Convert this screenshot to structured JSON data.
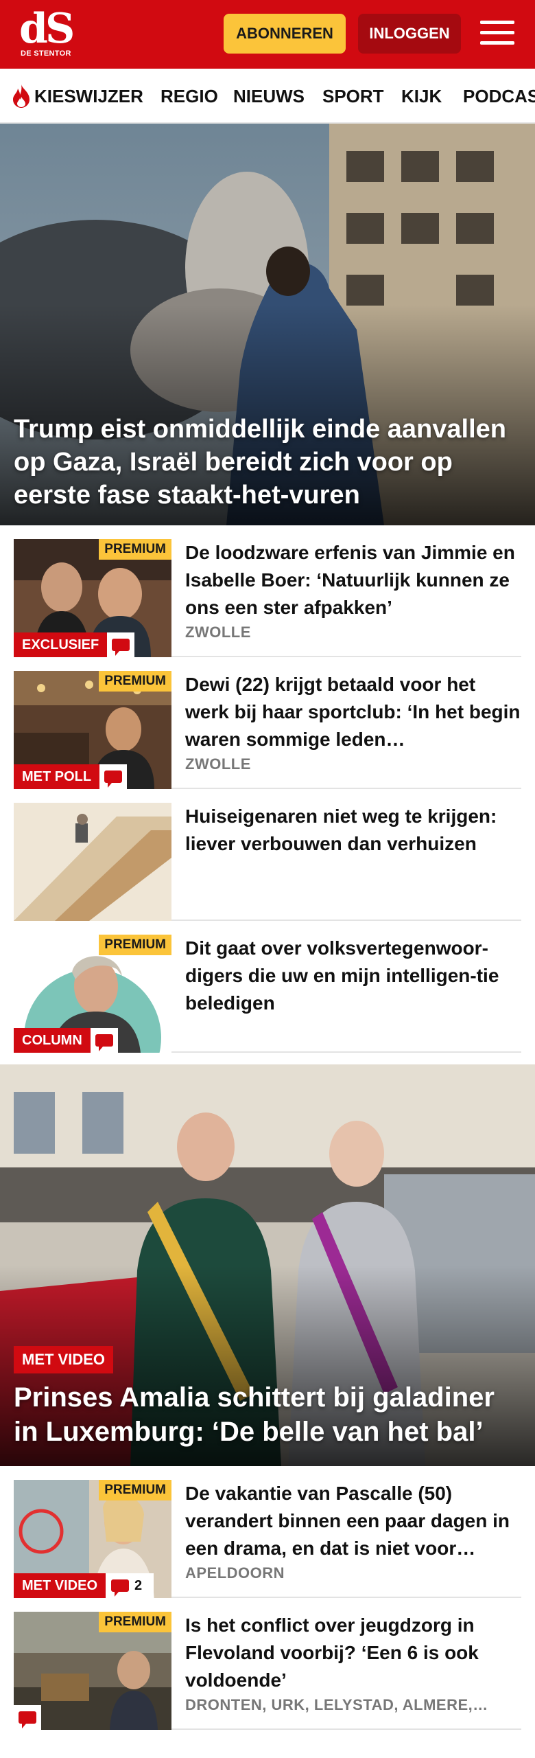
{
  "header": {
    "logo_mark": "dS",
    "logo_sub": "DE STENTOR",
    "subscribe_label": "ABONNEREN",
    "login_label": "INLOGGEN"
  },
  "nav": {
    "items": [
      "KIESWIJZER",
      "REGIO",
      "NIEUWS",
      "SPORT",
      "KIJK",
      "PODCAST"
    ]
  },
  "hero": {
    "title": "Trump eist onmiddellijk einde aanvallen op Gaza, Israël bereidt zich voor op eerste fase staakt-het-vuren"
  },
  "articles": [
    {
      "title": "De loodzware erfenis van Jimmie en Isabelle Boer: ‘Natuurlijk kunnen ze ons een ster afpakken’",
      "location": "ZWOLLE",
      "premium": "PREMIUM",
      "label": "EXCLUSIEF"
    },
    {
      "title": "Dewi (22) krijgt betaald voor het werk bij haar sportclub: ‘In het begin waren sommige leden…",
      "location": "ZWOLLE",
      "premium": "PREMIUM",
      "label": "MET POLL"
    },
    {
      "title": "Huiseigenaren niet weg te krijgen: liever verbouwen dan verhuizen"
    },
    {
      "title": "Dit gaat over volksvertegenwoor-digers die uw en mijn intelligen-tie beledigen",
      "premium": "PREMIUM",
      "label": "COLUMN"
    }
  ],
  "feature": {
    "label": "MET VIDEO",
    "title": "Prinses Amalia schittert bij galadiner in Luxemburg: ‘De belle van het bal’"
  },
  "articles2": [
    {
      "title": "De vakantie van Pascalle (50) verandert binnen een paar dagen in een drama, en dat is niet voor…",
      "location": "APELDOORN",
      "premium": "PREMIUM",
      "label": "MET VIDEO",
      "comments": "2"
    },
    {
      "title": "Is het conflict over jeugdzorg in Flevoland voorbij? ‘Een 6 is ook voldoende’",
      "location": "DRONTEN, URK, LELYSTAD, ALMERE,…",
      "premium": "PREMIUM"
    }
  ],
  "colors": {
    "brand_red": "#d10a11",
    "accent_yellow": "#fbc43a",
    "dark_red": "#a50a10"
  },
  "icons": [
    "menu-icon",
    "flame-icon",
    "comment-icon"
  ]
}
